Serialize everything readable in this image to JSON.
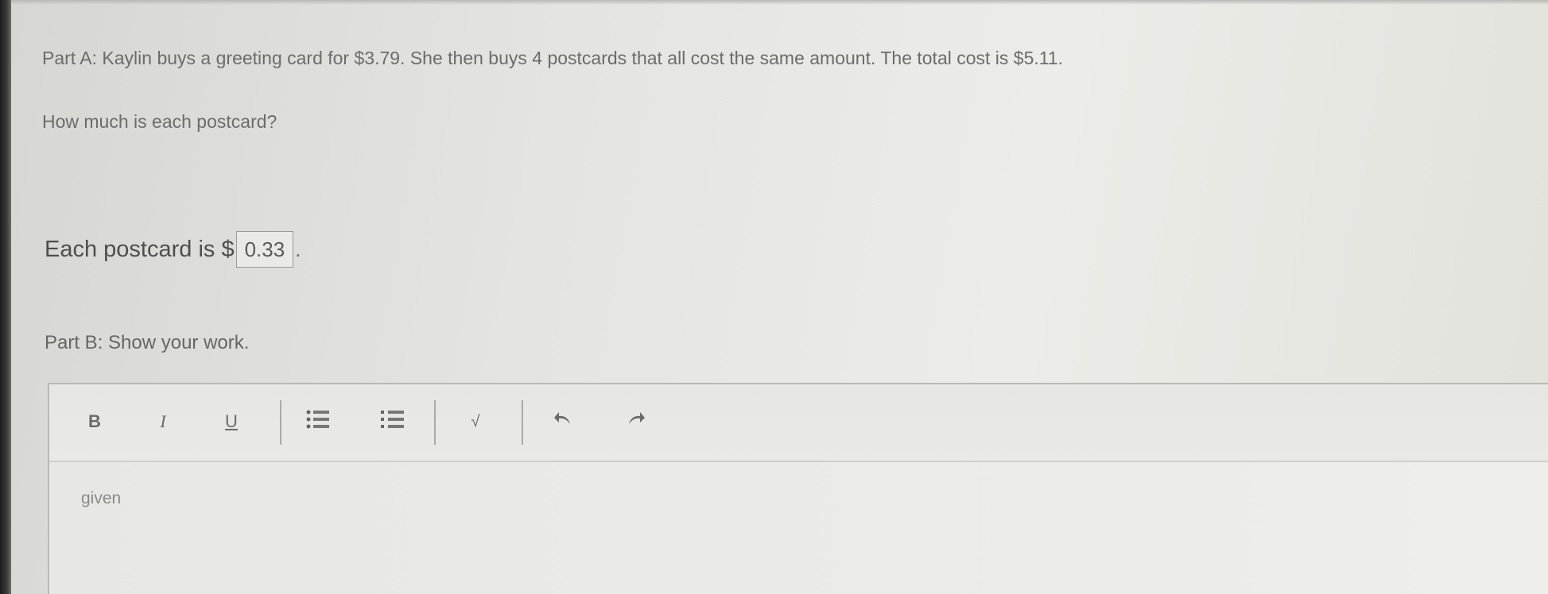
{
  "question": {
    "part_a_prompt": "Part A:  Kaylin buys a greeting card for $3.79.  She then buys 4 postcards that all cost the same amount.  The total cost is $5.11.",
    "part_a_question": "How much is each postcard?"
  },
  "answer": {
    "prefix": "Each postcard is $",
    "value": "0.33",
    "suffix": "."
  },
  "part_b": {
    "prompt": "Part B:  Show your work."
  },
  "toolbar": {
    "bold": "B",
    "italic": "I",
    "underline": "U",
    "sqrt": "√"
  },
  "editor": {
    "text": "given"
  }
}
